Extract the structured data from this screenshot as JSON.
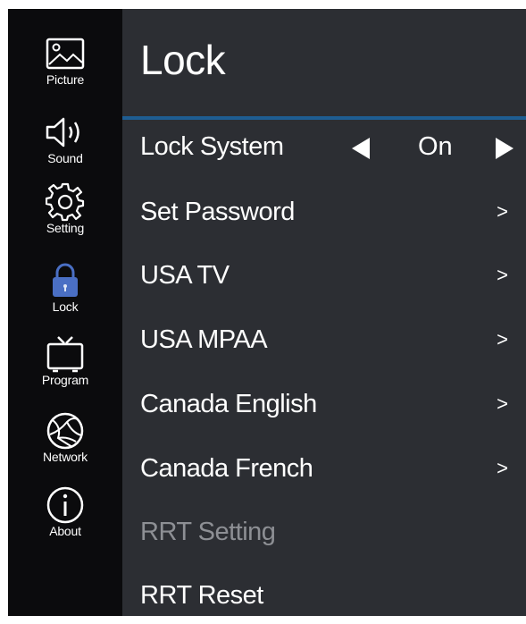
{
  "sidebar": {
    "items": [
      {
        "label": "Picture",
        "icon": "picture-icon"
      },
      {
        "label": "Sound",
        "icon": "speaker-icon"
      },
      {
        "label": "Setting",
        "icon": "gear-icon"
      },
      {
        "label": "Lock",
        "icon": "lock-icon",
        "selected": true
      },
      {
        "label": "Program",
        "icon": "tv-icon"
      },
      {
        "label": "Network",
        "icon": "globe-icon"
      },
      {
        "label": "About",
        "icon": "info-icon"
      }
    ]
  },
  "header": {
    "title": "Lock"
  },
  "menu": {
    "lock_system": {
      "label": "Lock System",
      "value": "On"
    },
    "items": [
      {
        "label": "Set Password",
        "chevron": ">"
      },
      {
        "label": "USA TV",
        "chevron": ">"
      },
      {
        "label": "USA MPAA",
        "chevron": ">"
      },
      {
        "label": "Canada English",
        "chevron": ">"
      },
      {
        "label": "Canada French",
        "chevron": ">"
      },
      {
        "label": "RRT Setting",
        "disabled": true
      },
      {
        "label": "RRT Reset"
      }
    ]
  },
  "colors": {
    "sidebar_bg": "#0b0b0d",
    "panel_bg": "#2c2e33",
    "accent": "#1e5d92",
    "lock_icon": "#4a6fc4",
    "disabled_text": "#8d8f94"
  }
}
